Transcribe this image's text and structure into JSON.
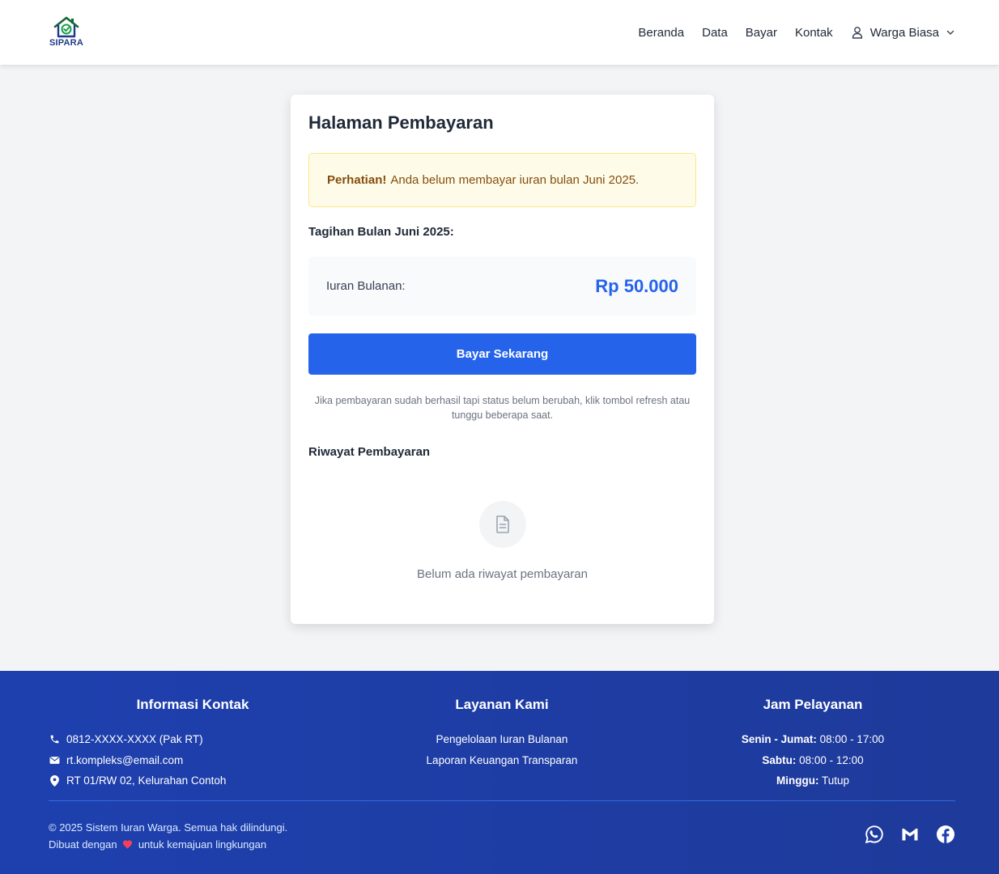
{
  "header": {
    "logo_text": "SIPARA",
    "nav": [
      "Beranda",
      "Data",
      "Bayar",
      "Kontak"
    ],
    "user_name": "Warga Biasa"
  },
  "card": {
    "title": "Halaman Pembayaran",
    "alert_strong": "Perhatian!",
    "alert_text": "Anda belum membayar iuran bulan Juni 2025.",
    "bill_heading": "Tagihan Bulan Juni 2025:",
    "fee_label": "Iuran Bulanan:",
    "fee_amount": "Rp 50.000",
    "pay_button": "Bayar Sekarang",
    "note": "Jika pembayaran sudah berhasil tapi status belum berubah, klik tombol refresh atau tunggu beberapa saat.",
    "history_heading": "Riwayat Pembayaran",
    "empty_text": "Belum ada riwayat pembayaran"
  },
  "footer": {
    "contact_title": "Informasi Kontak",
    "phone": "0812-XXXX-XXXX (Pak RT)",
    "email": "rt.kompleks@email.com",
    "address": "RT 01/RW 02, Kelurahan Contoh",
    "service_title": "Layanan Kami",
    "services": [
      "Pengelolaan Iuran Bulanan",
      "Laporan Keuangan Transparan"
    ],
    "hours_title": "Jam Pelayanan",
    "hours": [
      {
        "day": "Senin - Jumat:",
        "time": "08:00 - 17:00"
      },
      {
        "day": "Sabtu:",
        "time": "08:00 - 12:00"
      },
      {
        "day": "Minggu:",
        "time": "Tutup"
      }
    ],
    "copyright": "© 2025 Sistem Iuran Warga. Semua hak dilindungi.",
    "made_with_prefix": "Dibuat dengan",
    "made_with_suffix": "untuk kemajuan lingkungan",
    "socials": [
      "whatsapp-icon",
      "gmail-icon",
      "facebook-icon"
    ]
  },
  "colors": {
    "primary": "#2563eb",
    "footer": "#1e40af",
    "alert_bg": "#fefce8",
    "alert_text": "#854d0e"
  }
}
